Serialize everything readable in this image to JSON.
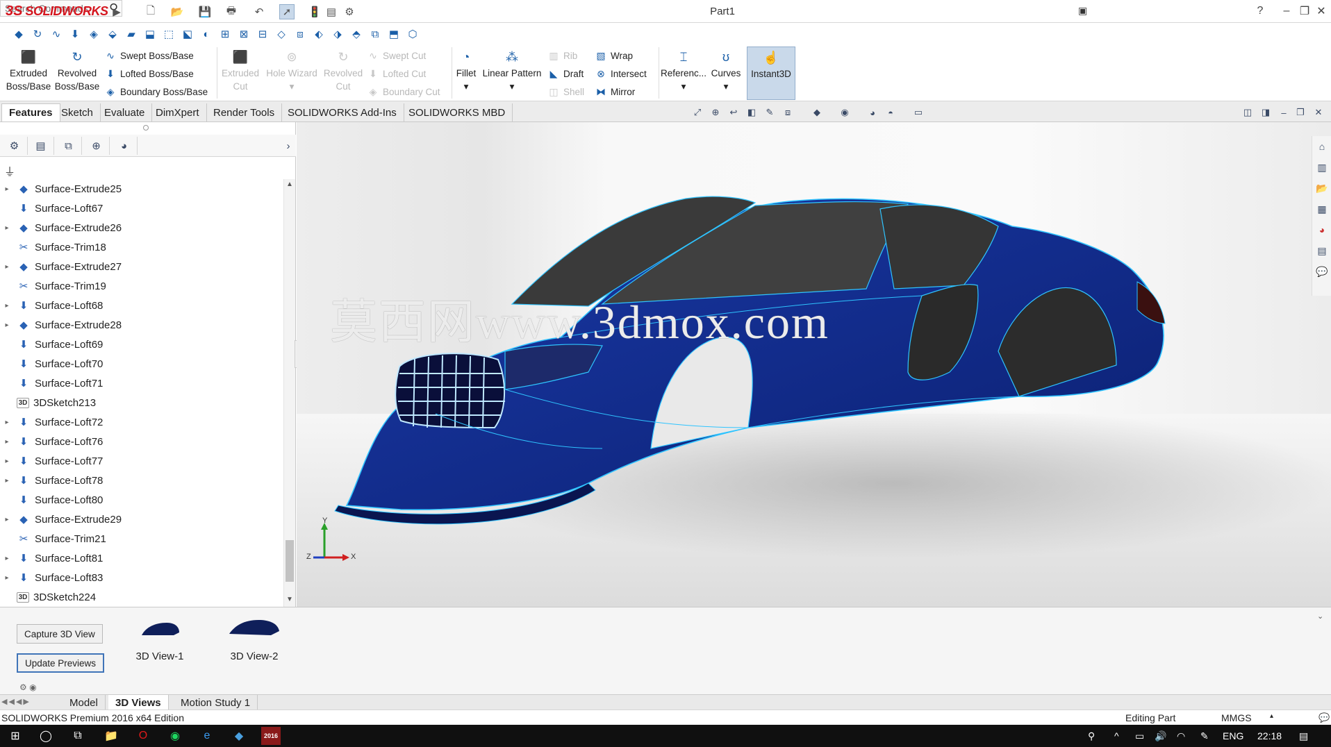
{
  "app": {
    "brand_prefix": "3S",
    "brand_name": "SOLIDWORKS",
    "document_title": "Part1"
  },
  "search": {
    "placeholder": "Search Commands"
  },
  "ribbon": {
    "extruded_boss": [
      "Extruded",
      "Boss/Base"
    ],
    "revolved_boss": [
      "Revolved",
      "Boss/Base"
    ],
    "swept_boss": "Swept Boss/Base",
    "lofted_boss": "Lofted Boss/Base",
    "boundary_boss": "Boundary Boss/Base",
    "extruded_cut": [
      "Extruded",
      "Cut"
    ],
    "hole_wizard": "Hole Wizard",
    "revolved_cut": [
      "Revolved",
      "Cut"
    ],
    "swept_cut": "Swept Cut",
    "lofted_cut": "Lofted Cut",
    "boundary_cut": "Boundary Cut",
    "fillet": "Fillet",
    "linear_pattern": "Linear Pattern",
    "rib": "Rib",
    "draft": "Draft",
    "shell": "Shell",
    "wrap": "Wrap",
    "intersect": "Intersect",
    "mirror": "Mirror",
    "reference": "Referenc...",
    "curves": "Curves",
    "instant3d": "Instant3D"
  },
  "command_tabs": [
    {
      "label": "Features",
      "active": true
    },
    {
      "label": "Sketch",
      "active": false
    },
    {
      "label": "Evaluate",
      "active": false
    },
    {
      "label": "DimXpert",
      "active": false
    },
    {
      "label": "Render Tools",
      "active": false
    },
    {
      "label": "SOLIDWORKS Add-Ins",
      "active": false
    },
    {
      "label": "SOLIDWORKS MBD",
      "active": false
    }
  ],
  "feature_tree": [
    {
      "label": "Surface-Extrude25",
      "icon": "surface-extrude-icon",
      "expandable": true
    },
    {
      "label": "Surface-Loft67",
      "icon": "surface-loft-icon",
      "expandable": false
    },
    {
      "label": "Surface-Extrude26",
      "icon": "surface-extrude-icon",
      "expandable": true
    },
    {
      "label": "Surface-Trim18",
      "icon": "surface-trim-icon",
      "expandable": false
    },
    {
      "label": "Surface-Extrude27",
      "icon": "surface-extrude-icon",
      "expandable": true
    },
    {
      "label": "Surface-Trim19",
      "icon": "surface-trim-icon",
      "expandable": false
    },
    {
      "label": "Surface-Loft68",
      "icon": "surface-loft-icon",
      "expandable": true
    },
    {
      "label": "Surface-Extrude28",
      "icon": "surface-extrude-icon",
      "expandable": true
    },
    {
      "label": "Surface-Loft69",
      "icon": "surface-loft-icon",
      "expandable": false
    },
    {
      "label": "Surface-Loft70",
      "icon": "surface-loft-icon",
      "expandable": false
    },
    {
      "label": "Surface-Loft71",
      "icon": "surface-loft-icon",
      "expandable": false
    },
    {
      "label": "3DSketch213",
      "icon": "3d-sketch-icon",
      "expandable": false
    },
    {
      "label": "Surface-Loft72",
      "icon": "surface-loft-icon",
      "expandable": true
    },
    {
      "label": "Surface-Loft76",
      "icon": "surface-loft-icon",
      "expandable": true
    },
    {
      "label": "Surface-Loft77",
      "icon": "surface-loft-icon",
      "expandable": true
    },
    {
      "label": "Surface-Loft78",
      "icon": "surface-loft-icon",
      "expandable": true
    },
    {
      "label": "Surface-Loft80",
      "icon": "surface-loft-icon",
      "expandable": false
    },
    {
      "label": "Surface-Extrude29",
      "icon": "surface-extrude-icon",
      "expandable": true
    },
    {
      "label": "Surface-Trim21",
      "icon": "surface-trim-icon",
      "expandable": false
    },
    {
      "label": "Surface-Loft81",
      "icon": "surface-loft-icon",
      "expandable": true
    },
    {
      "label": "Surface-Loft83",
      "icon": "surface-loft-icon",
      "expandable": true
    },
    {
      "label": "3DSketch224",
      "icon": "3d-sketch-icon",
      "expandable": false
    }
  ],
  "sketch_icon_text": "3D",
  "viewport": {
    "watermark": "莫西网www.3dmox.com",
    "triad": {
      "x": "X",
      "y": "Y",
      "z": "Z"
    }
  },
  "views_panel": {
    "capture_button": "Capture 3D View",
    "update_button": "Update Previews",
    "views": [
      "3D View-1",
      "3D View-2"
    ]
  },
  "model_tabs": [
    {
      "label": "Model",
      "active": false
    },
    {
      "label": "3D Views",
      "active": true
    },
    {
      "label": "Motion Study 1",
      "active": false
    }
  ],
  "status": {
    "edition": "SOLIDWORKS Premium 2016 x64 Edition",
    "mode": "Editing Part",
    "units": "MMGS"
  },
  "taskbar": {
    "language": "ENG",
    "time": "22:18",
    "sw_badge": "2016"
  },
  "colors": {
    "brand_red": "#d5161f",
    "car_body": "#0f2a8a",
    "edge_highlight": "#2fc4ff",
    "accent_blue": "#1b5fa8"
  }
}
